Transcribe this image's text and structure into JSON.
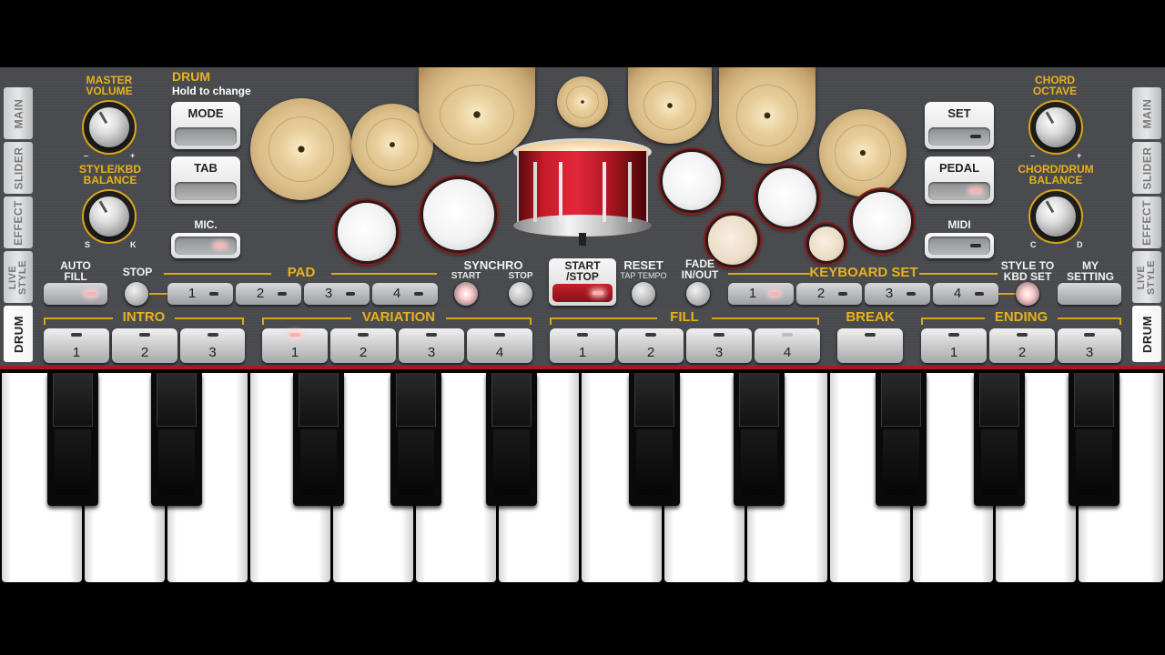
{
  "side_tabs": [
    "MAIN",
    "SLIDER",
    "EFFECT",
    "LIVE\nSTYLE",
    "DRUM"
  ],
  "left_panel": {
    "master_volume": "MASTER\nVOLUME",
    "style_kbd_balance": "STYLE/KBD\nBALANCE",
    "minus": "–",
    "plus": "+",
    "s": "S",
    "k": "K"
  },
  "drum_header": {
    "title": "DRUM",
    "subtitle": "Hold to change"
  },
  "buttons": {
    "mode": "MODE",
    "tab": "TAB",
    "mic": "MIC.",
    "set": "SET",
    "pedal": "PEDAL",
    "midi": "MIDI"
  },
  "right_panel": {
    "chord_octave": "CHORD\nOCTAVE",
    "chord_drum_balance": "CHORD/DRUM\nBALANCE",
    "c": "C",
    "d": "D"
  },
  "controls": {
    "auto_fill": "AUTO\nFILL",
    "stop": "STOP",
    "pad": "PAD",
    "pad_buttons": [
      "1",
      "2",
      "3",
      "4"
    ],
    "synchro": "SYNCHRO",
    "synchro_start": "START",
    "synchro_stop": "STOP",
    "start_stop": "START\n/STOP",
    "reset": "RESET",
    "tap_tempo": "TAP TEMPO",
    "fade": "FADE\nIN/OUT",
    "keyboard_set": "KEYBOARD SET",
    "kbd_buttons": [
      "1",
      "2",
      "3",
      "4"
    ],
    "style_to_kbd": "STYLE TO\nKBD SET",
    "my_setting": "MY\nSETTING"
  },
  "sections": {
    "intro": {
      "label": "INTRO",
      "buttons": [
        "1",
        "2",
        "3"
      ]
    },
    "variation": {
      "label": "VARIATION",
      "buttons": [
        "1",
        "2",
        "3",
        "4"
      ]
    },
    "fill": {
      "label": "FILL",
      "buttons": [
        "1",
        "2",
        "3",
        "4"
      ]
    },
    "break": {
      "label": "BREAK"
    },
    "ending": {
      "label": "ENDING",
      "buttons": [
        "1",
        "2",
        "3"
      ]
    }
  },
  "colors": {
    "accent_gold": "#e8b21c",
    "snare_red": "#b01622",
    "led_on": "#ffb0b0"
  }
}
